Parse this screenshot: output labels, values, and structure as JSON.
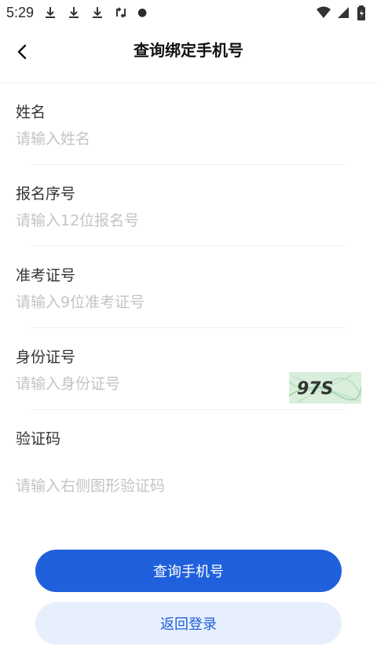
{
  "status_bar": {
    "time": "5:29",
    "left_icons": [
      "download-icon",
      "download-icon",
      "download-icon",
      "sync-icon"
    ],
    "right_icons": [
      "wifi-icon",
      "signal-icon",
      "battery-icon"
    ]
  },
  "header": {
    "title": "查询绑定手机号",
    "back_icon": "chevron-left-icon"
  },
  "form": {
    "name": {
      "label": "姓名",
      "placeholder": "请输入姓名"
    },
    "registration_no": {
      "label": "报名序号",
      "placeholder": "请输入12位报名号"
    },
    "admission_no": {
      "label": "准考证号",
      "placeholder": "请输入9位准考证号"
    },
    "id_card": {
      "label": "身份证号",
      "placeholder": "请输入身份证号"
    },
    "captcha": {
      "label": "验证码",
      "placeholder": "请输入右侧图形验证码",
      "image_text": "97S"
    }
  },
  "buttons": {
    "query_label": "查询手机号",
    "back_login_label": "返回登录"
  },
  "colors": {
    "primary": "#1f60dc",
    "secondary_bg": "#e8effc",
    "placeholder": "#c4c4c4"
  }
}
